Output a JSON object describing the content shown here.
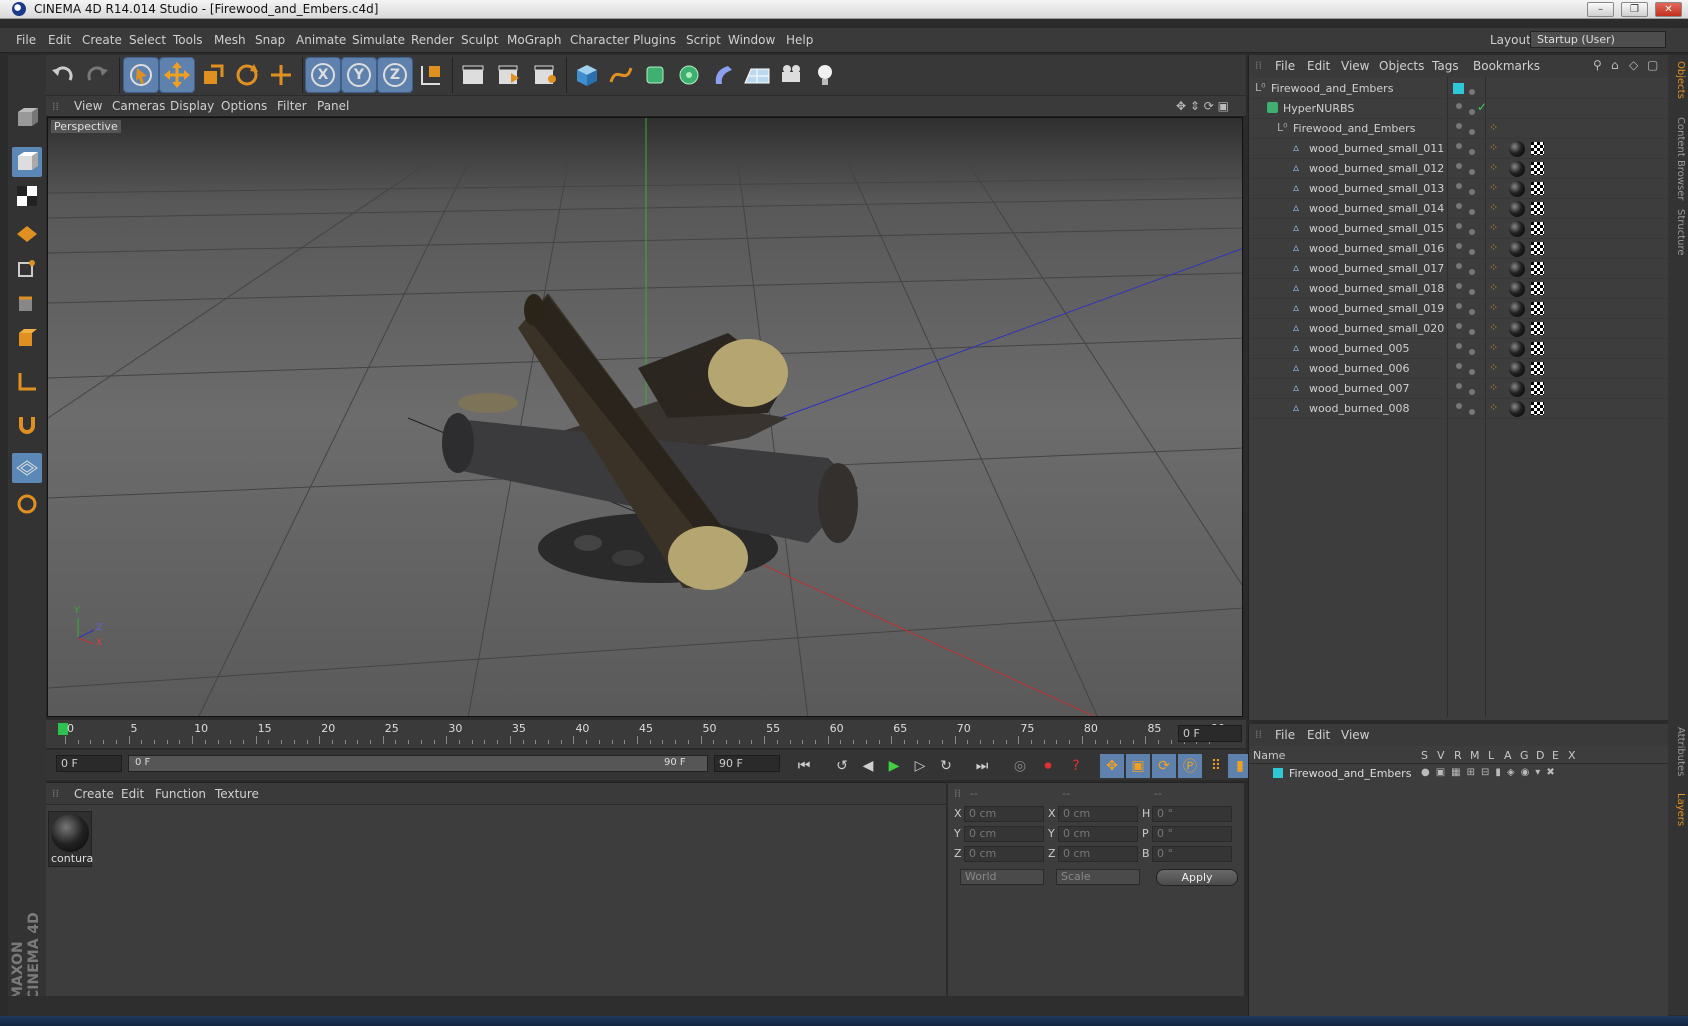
{
  "window": {
    "title": "CINEMA 4D R14.014 Studio - [Firewood_and_Embers.c4d]",
    "minimize_glyph": "–",
    "restore_glyph": "❐",
    "close_glyph": "✕"
  },
  "menubar": {
    "items": [
      "File",
      "Edit",
      "Create",
      "Select",
      "Tools",
      "Mesh",
      "Snap",
      "Animate",
      "Simulate",
      "Render",
      "Sculpt",
      "MoGraph",
      "Character",
      "Plugins",
      "Script",
      "Window",
      "Help"
    ],
    "layout_label": "Layout:",
    "layout_value": "Startup (User)"
  },
  "toolbar": {
    "axis_x": "X",
    "axis_y": "Y",
    "axis_z": "Z"
  },
  "viewport": {
    "menu": [
      "View",
      "Cameras",
      "Display",
      "Options",
      "Filter",
      "Panel"
    ],
    "label": "Perspective",
    "axis_y": "Y",
    "axis_z": "Z",
    "axis_x": "X"
  },
  "timeline": {
    "ticks": [
      "0",
      "5",
      "10",
      "15",
      "20",
      "25",
      "30",
      "35",
      "40",
      "45",
      "50",
      "55",
      "60",
      "65",
      "70",
      "75",
      "80",
      "85",
      "90"
    ],
    "current_frame": "0 F"
  },
  "transport": {
    "start_field": "0 F",
    "range_start": "0 F",
    "range_end": "90 F",
    "end_field": "90 F"
  },
  "material_manager": {
    "menu": [
      "Create",
      "Edit",
      "Function",
      "Texture"
    ],
    "material_name": "contura"
  },
  "coordinates": {
    "headers": [
      "--",
      "--",
      "--"
    ],
    "rows": [
      {
        "a": "X",
        "a_val": "0 cm",
        "b": "X",
        "b_val": "0 cm",
        "c": "H",
        "c_val": "0 °"
      },
      {
        "a": "Y",
        "a_val": "0 cm",
        "b": "Y",
        "b_val": "0 cm",
        "c": "P",
        "c_val": "0 °"
      },
      {
        "a": "Z",
        "a_val": "0 cm",
        "b": "Z",
        "b_val": "0 cm",
        "c": "B",
        "c_val": "0 °"
      }
    ],
    "mode1": "World",
    "mode2": "Scale",
    "apply": "Apply"
  },
  "object_manager": {
    "menu": [
      "File",
      "Edit",
      "View",
      "Objects",
      "Tags",
      "Bookmarks"
    ],
    "objects": [
      {
        "name": "Firewood_and_Embers"
      },
      {
        "name": "HyperNURBS"
      },
      {
        "name": "Firewood_and_Embers"
      },
      {
        "name": "wood_burned_small_011"
      },
      {
        "name": "wood_burned_small_012"
      },
      {
        "name": "wood_burned_small_013"
      },
      {
        "name": "wood_burned_small_014"
      },
      {
        "name": "wood_burned_small_015"
      },
      {
        "name": "wood_burned_small_016"
      },
      {
        "name": "wood_burned_small_017"
      },
      {
        "name": "wood_burned_small_018"
      },
      {
        "name": "wood_burned_small_019"
      },
      {
        "name": "wood_burned_small_020"
      },
      {
        "name": "wood_burned_005"
      },
      {
        "name": "wood_burned_006"
      },
      {
        "name": "wood_burned_007"
      },
      {
        "name": "wood_burned_008"
      }
    ]
  },
  "layer_manager": {
    "menu": [
      "File",
      "Edit",
      "View"
    ],
    "columns": [
      "Name",
      "S",
      "V",
      "R",
      "M",
      "L",
      "A",
      "G",
      "D",
      "E",
      "X"
    ],
    "layers": [
      {
        "name": "Firewood_and_Embers"
      }
    ]
  },
  "side_tabs": [
    "Objects",
    "Content Browser",
    "Structure",
    "Attributes",
    "Layers"
  ],
  "branding": {
    "line1": "MAXON",
    "line2": "CINEMA 4D"
  },
  "colors": {
    "accent": "#5e82ad",
    "layer_color": "#2ec8d8",
    "axis_x": "#c03030",
    "axis_y": "#30b030",
    "axis_z": "#3030c0"
  }
}
